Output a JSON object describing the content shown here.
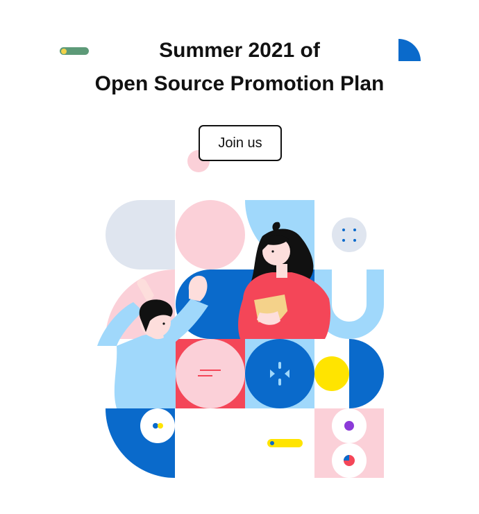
{
  "hero": {
    "title_line1": "Summer 2021 of",
    "title_line2": "Open Source Promotion Plan",
    "join_button_label": "Join us"
  },
  "colors": {
    "brand_blue": "#0a6acb",
    "light_blue": "#a0d8fb",
    "pink": "#fbd0d8",
    "red": "#f44658",
    "yellow": "#ffe400",
    "grey": "#dfe5ef",
    "green": "#5d9a78"
  },
  "icons": [
    "pill-decoration",
    "quarter-circle-decoration",
    "dot-decoration",
    "dots-grid-icon",
    "sparkle-icon",
    "pie-chart-icon",
    "toggle-icon"
  ]
}
